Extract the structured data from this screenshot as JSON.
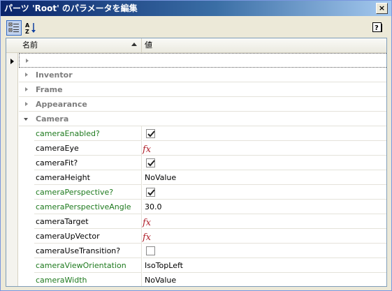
{
  "window": {
    "title": "パーツ 'Root' のパラメータを編集",
    "close_label": "×"
  },
  "toolbar": {
    "categorized_icon": "categorized-icon",
    "alphabetical_label": "A↓Z",
    "help_icon": "help-icon"
  },
  "grid": {
    "headers": {
      "name": "名前",
      "value": "値"
    },
    "new_row_arrow": "›",
    "groups": [
      "Inventor",
      "Frame",
      "Appearance",
      "Camera"
    ],
    "properties": [
      {
        "name": "cameraEnabled?",
        "value": "",
        "checkbox": true,
        "checked": true,
        "fx": false,
        "green": true
      },
      {
        "name": "cameraEye",
        "value": "",
        "checkbox": false,
        "checked": false,
        "fx": true,
        "green": false
      },
      {
        "name": "cameraFit?",
        "value": "",
        "checkbox": true,
        "checked": true,
        "fx": false,
        "green": false
      },
      {
        "name": "cameraHeight",
        "value": "NoValue",
        "checkbox": false,
        "checked": false,
        "fx": false,
        "green": false
      },
      {
        "name": "cameraPerspective?",
        "value": "",
        "checkbox": true,
        "checked": true,
        "fx": false,
        "green": true
      },
      {
        "name": "cameraPerspectiveAngle",
        "value": "30.0",
        "checkbox": false,
        "checked": false,
        "fx": false,
        "green": true
      },
      {
        "name": "cameraTarget",
        "value": "",
        "checkbox": false,
        "checked": false,
        "fx": true,
        "green": false
      },
      {
        "name": "cameraUpVector",
        "value": "",
        "checkbox": false,
        "checked": false,
        "fx": true,
        "green": false
      },
      {
        "name": "cameraUseTransition?",
        "value": "",
        "checkbox": true,
        "checked": false,
        "fx": false,
        "green": false
      },
      {
        "name": "cameraViewOrientation",
        "value": "IsoTopLeft",
        "checkbox": false,
        "checked": false,
        "fx": false,
        "green": true
      },
      {
        "name": "cameraWidth",
        "value": "NoValue",
        "checkbox": false,
        "checked": false,
        "fx": false,
        "green": true
      }
    ],
    "fx_label": "fx"
  },
  "colors": {
    "inherited_name": "#1e7a1e",
    "fx_red": "#b0202a",
    "titlebar": "#0a246a"
  }
}
